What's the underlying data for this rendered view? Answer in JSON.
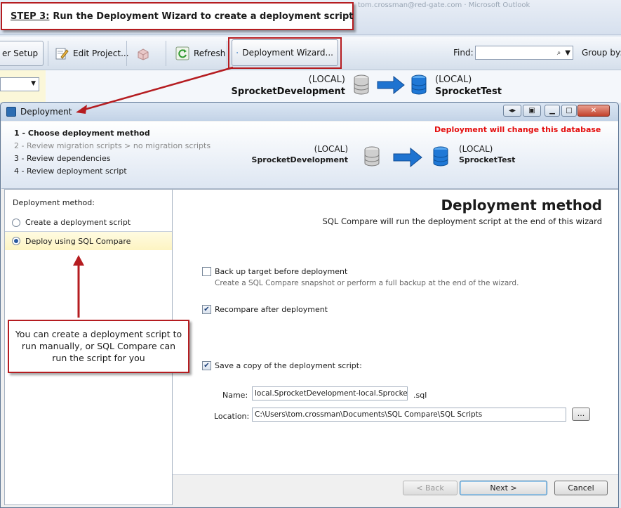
{
  "banner": {
    "step": "STEP 3:",
    "text": "Run the Deployment Wizard to create a deployment script"
  },
  "background": {
    "ghost_text": "tom.crossman@red-gate.com · Microsoft Outlook",
    "toolbar": {
      "setup_label": "er Setup",
      "edit_project_label": "Edit Project...",
      "refresh_label": "Refresh",
      "deployment_wizard_label": "Deployment Wizard...",
      "find_label": "Find:",
      "find_value": "",
      "group_by_label": "Group by:"
    },
    "source": {
      "server": "(LOCAL)",
      "database": "SprocketDevelopment"
    },
    "target": {
      "server": "(LOCAL)",
      "database": "SprocketTest"
    }
  },
  "dialog": {
    "title": "Deployment",
    "steps": [
      {
        "label": "1 - Choose deployment method",
        "state": "current"
      },
      {
        "label": "2 - Review migration scripts > no migration scripts",
        "state": "disabled"
      },
      {
        "label": "3 - Review dependencies",
        "state": "normal"
      },
      {
        "label": "4 - Review deployment script",
        "state": "normal"
      }
    ],
    "warning": "Deployment will change this database",
    "source": {
      "server": "(LOCAL)",
      "database": "SprocketDevelopment"
    },
    "target": {
      "server": "(LOCAL)",
      "database": "SprocketTest"
    },
    "method_label": "Deployment method:",
    "methods": [
      {
        "label": "Create a deployment script",
        "selected": false
      },
      {
        "label": "Deploy using SQL Compare",
        "selected": true
      }
    ],
    "section_title": "Deployment method",
    "section_subtitle": "SQL Compare will run the deployment script at the end of this wizard",
    "options": {
      "backup_label": "Back up target before deployment",
      "backup_checked": false,
      "backup_desc": "Create a SQL Compare snapshot or perform a full backup at the end of the wizard.",
      "recompare_label": "Recompare after deployment",
      "recompare_checked": true,
      "save_copy_label": "Save a copy of the deployment script:",
      "save_copy_checked": true
    },
    "name_label": "Name:",
    "name_value": "local.SprocketDevelopment-local.SprocketTes",
    "name_ext": ".sql",
    "location_label": "Location:",
    "location_value": "C:\\Users\\tom.crossman\\Documents\\SQL Compare\\SQL Scripts",
    "browse_label": "...",
    "buttons": {
      "back": "< Back",
      "next": "Next >",
      "cancel": "Cancel"
    }
  },
  "note": "You can create a deployment script to run manually, or SQL Compare can run the script for you",
  "colors": {
    "callout_red": "#b51c20",
    "warning_red": "#e40d0d",
    "arrow_blue": "#1e73d0"
  }
}
